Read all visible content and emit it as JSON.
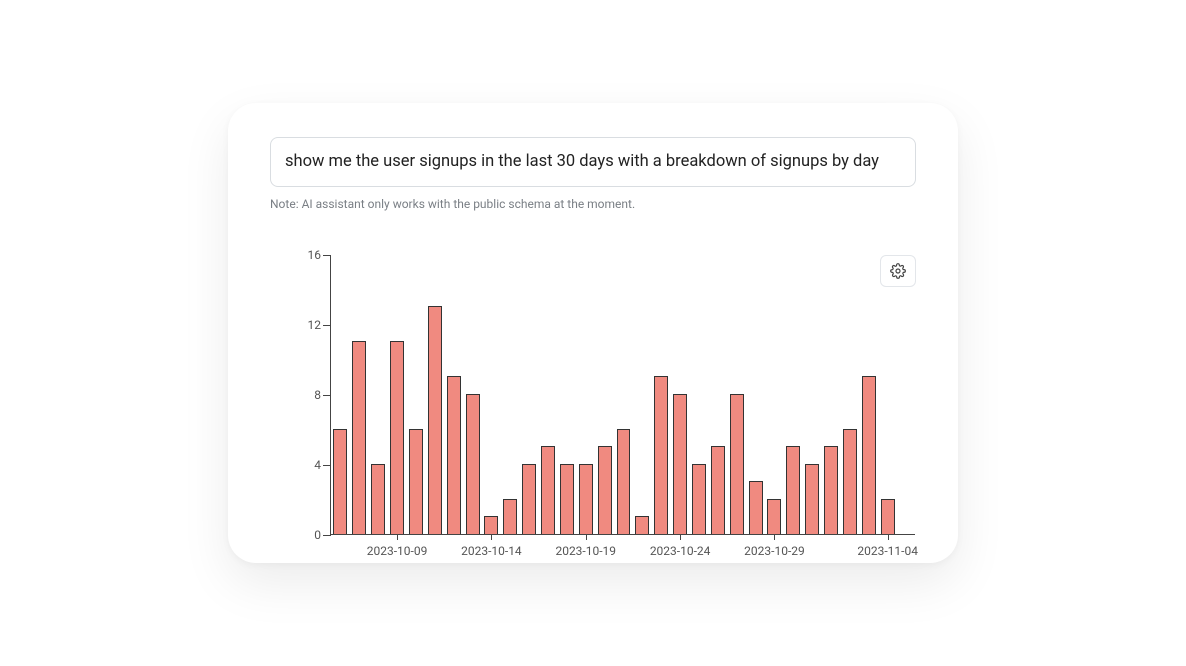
{
  "query": {
    "text": "show me the user signups in the last 30 days with a breakdown of signups by day"
  },
  "note": "Note: AI assistant only works with the public schema at the moment.",
  "settings_button": {
    "name": "gear-icon"
  },
  "chart_data": {
    "type": "bar",
    "title": "",
    "xlabel": "",
    "ylabel": "",
    "ylim": [
      0,
      16
    ],
    "y_ticks": [
      0,
      4,
      8,
      12,
      16
    ],
    "x_tick_labels": [
      "2023-10-09",
      "2023-10-14",
      "2023-10-19",
      "2023-10-24",
      "2023-10-29",
      "2023-11-04"
    ],
    "categories": [
      "2023-10-06",
      "2023-10-07",
      "2023-10-08",
      "2023-10-09",
      "2023-10-10",
      "2023-10-11",
      "2023-10-12",
      "2023-10-13",
      "2023-10-14",
      "2023-10-15",
      "2023-10-16",
      "2023-10-17",
      "2023-10-18",
      "2023-10-19",
      "2023-10-20",
      "2023-10-21",
      "2023-10-22",
      "2023-10-23",
      "2023-10-24",
      "2023-10-25",
      "2023-10-26",
      "2023-10-27",
      "2023-10-28",
      "2023-10-29",
      "2023-10-30",
      "2023-10-31",
      "2023-11-01",
      "2023-11-02",
      "2023-11-03",
      "2023-11-04",
      "2023-11-05"
    ],
    "values": [
      6,
      11,
      4,
      11,
      6,
      13,
      9,
      8,
      1,
      2,
      4,
      5,
      4,
      4,
      5,
      6,
      1,
      9,
      8,
      4,
      5,
      8,
      3,
      2,
      5,
      4,
      5,
      6,
      9,
      2,
      0
    ]
  }
}
